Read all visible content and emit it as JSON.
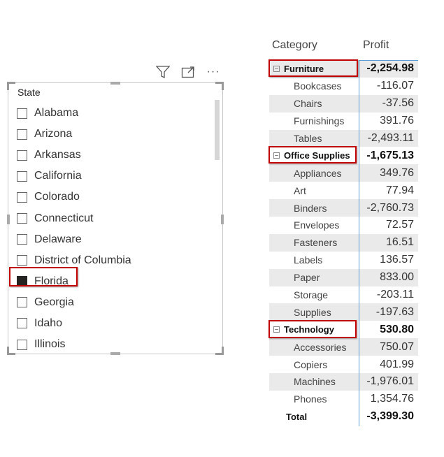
{
  "slicer": {
    "title": "State",
    "header_icons": [
      "filter-icon",
      "focus-mode-icon",
      "more-options-icon"
    ],
    "more_options_glyph": "···",
    "items": [
      {
        "label": "Alabama",
        "checked": false
      },
      {
        "label": "Arizona",
        "checked": false
      },
      {
        "label": "Arkansas",
        "checked": false
      },
      {
        "label": "California",
        "checked": false
      },
      {
        "label": "Colorado",
        "checked": false
      },
      {
        "label": "Connecticut",
        "checked": false
      },
      {
        "label": "Delaware",
        "checked": false
      },
      {
        "label": "District of Columbia",
        "checked": false
      },
      {
        "label": "Florida",
        "checked": true
      },
      {
        "label": "Georgia",
        "checked": false
      },
      {
        "label": "Idaho",
        "checked": false
      },
      {
        "label": "Illinois",
        "checked": false
      }
    ],
    "highlight_color": "#c00000"
  },
  "matrix": {
    "headers": {
      "category": "Category",
      "profit": "Profit"
    },
    "rows": [
      {
        "type": "group",
        "label": "Furniture",
        "value": "-2,254.98"
      },
      {
        "type": "sub",
        "label": "Bookcases",
        "value": "-116.07"
      },
      {
        "type": "sub",
        "label": "Chairs",
        "value": "-37.56"
      },
      {
        "type": "sub",
        "label": "Furnishings",
        "value": "391.76"
      },
      {
        "type": "sub",
        "label": "Tables",
        "value": "-2,493.11"
      },
      {
        "type": "group",
        "label": "Office Supplies",
        "value": "-1,675.13"
      },
      {
        "type": "sub",
        "label": "Appliances",
        "value": "349.76"
      },
      {
        "type": "sub",
        "label": "Art",
        "value": "77.94"
      },
      {
        "type": "sub",
        "label": "Binders",
        "value": "-2,760.73"
      },
      {
        "type": "sub",
        "label": "Envelopes",
        "value": "72.57"
      },
      {
        "type": "sub",
        "label": "Fasteners",
        "value": "16.51"
      },
      {
        "type": "sub",
        "label": "Labels",
        "value": "136.57"
      },
      {
        "type": "sub",
        "label": "Paper",
        "value": "833.00"
      },
      {
        "type": "sub",
        "label": "Storage",
        "value": "-203.11"
      },
      {
        "type": "sub",
        "label": "Supplies",
        "value": "-197.63"
      },
      {
        "type": "group",
        "label": "Technology",
        "value": "530.80"
      },
      {
        "type": "sub",
        "label": "Accessories",
        "value": "750.07"
      },
      {
        "type": "sub",
        "label": "Copiers",
        "value": "401.99"
      },
      {
        "type": "sub",
        "label": "Machines",
        "value": "-1,976.01"
      },
      {
        "type": "sub",
        "label": "Phones",
        "value": "1,354.76"
      },
      {
        "type": "total",
        "label": "Total",
        "value": "-3,399.30"
      }
    ],
    "accent_line_color": "#5b9bd5"
  }
}
